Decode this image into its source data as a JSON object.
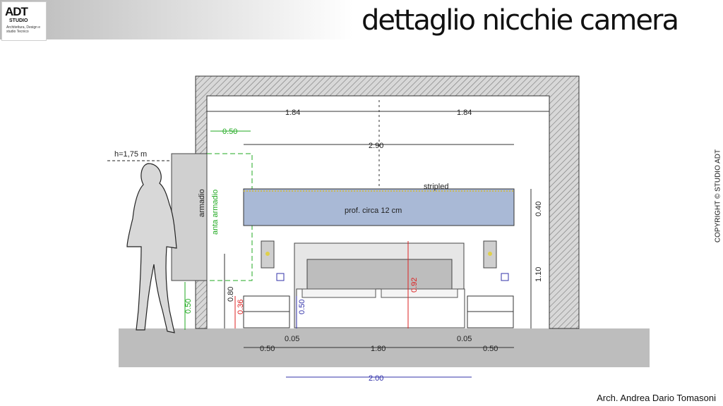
{
  "header": {
    "logo_mark": "ADT",
    "logo_studio": "STUDIO",
    "logo_tagline": "Architettura, Design e studio Tecnico",
    "title": "dettaglio nicchie camera"
  },
  "side_text": {
    "copyright": "COPYRIGHT © STUDIO ADT"
  },
  "footer": {
    "author": "Arch. Andrea Dario Tomasoni"
  },
  "drawing": {
    "person_height": "h=1,75 m",
    "wardrobe_label": "armadio",
    "wardrobe_door_label": "anta armadio",
    "shelf_label": "stripled",
    "shelf_depth": "prof. circa 12 cm",
    "dims": {
      "half_width_left": "1.84",
      "half_width_right": "1.84",
      "niche_width": "2.90",
      "door_offset": "0.50",
      "shelf_height": "0.40",
      "shelf_elevation": "1.10",
      "headboard_height": "0.92",
      "lamp_height": "0.80",
      "nightstand_height": "0.36",
      "nightstand_gap": "0.50",
      "person_base": "0.50",
      "nightstand_left_width": "0.50",
      "gap_left": "0.05",
      "bed_width": "1.80",
      "gap_right": "0.05",
      "nightstand_right_width": "0.50",
      "total_width": "2.00"
    }
  },
  "colors": {
    "dim_green": "#22aa22",
    "dim_red": "#dd2222",
    "dim_blue": "#3333aa",
    "shelf_blue": "#a9b9d6"
  }
}
